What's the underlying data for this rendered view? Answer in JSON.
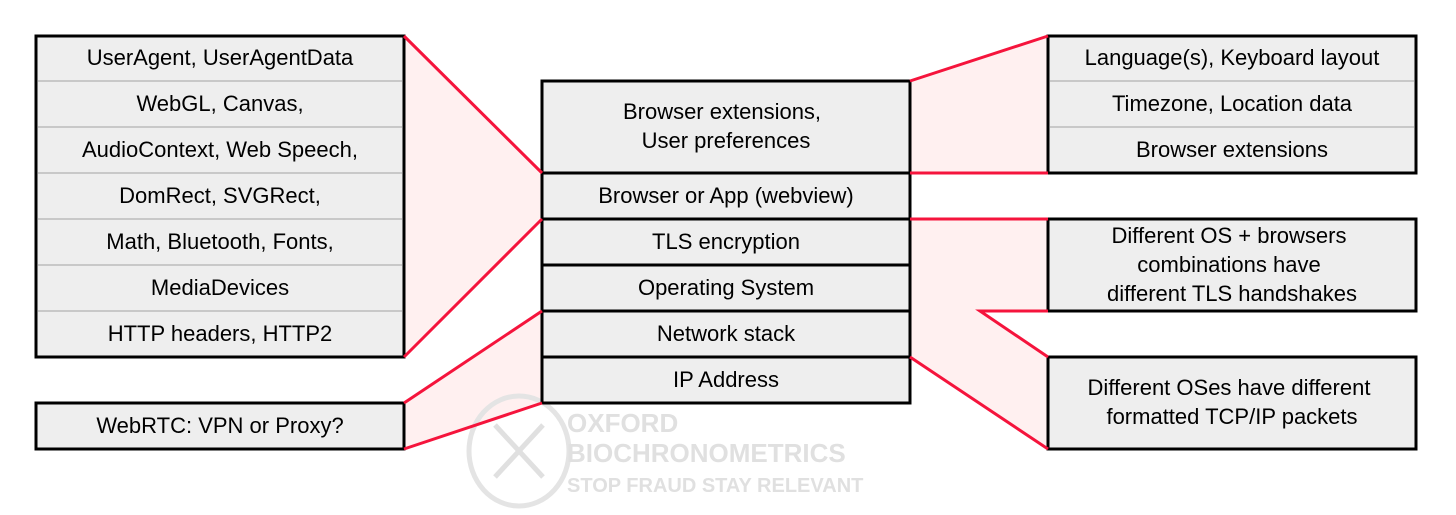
{
  "left_list": [
    "UserAgent, UserAgentData",
    "WebGL, Canvas,",
    "AudioContext, Web Speech,",
    "DomRect, SVGRect,",
    "Math, Bluetooth, Fonts,",
    "MediaDevices",
    "HTTP headers, HTTP2"
  ],
  "left_bottom": "WebRTC: VPN or Proxy?",
  "center_stack": [
    "Browser extensions,",
    "User preferences",
    "Browser or App (webview)",
    "TLS encryption",
    "Operating System",
    "Network stack",
    "IP Address"
  ],
  "right_top": [
    "Language(s), Keyboard layout",
    "Timezone, Location data",
    "Browser extensions"
  ],
  "right_mid": [
    "Different OS + browsers",
    "combinations have",
    "different TLS handshakes"
  ],
  "right_bottom": [
    "Different OSes have different",
    "formatted TCP/IP packets"
  ],
  "watermark": {
    "line1": "OXFORD",
    "line2": "BIOCHRONOMETRICS",
    "line3": "STOP FRAUD  STAY RELEVANT"
  },
  "colors": {
    "connector": "#f5143c",
    "connector_fill": "#fff0f0",
    "box_fill": "#eeeeee"
  }
}
